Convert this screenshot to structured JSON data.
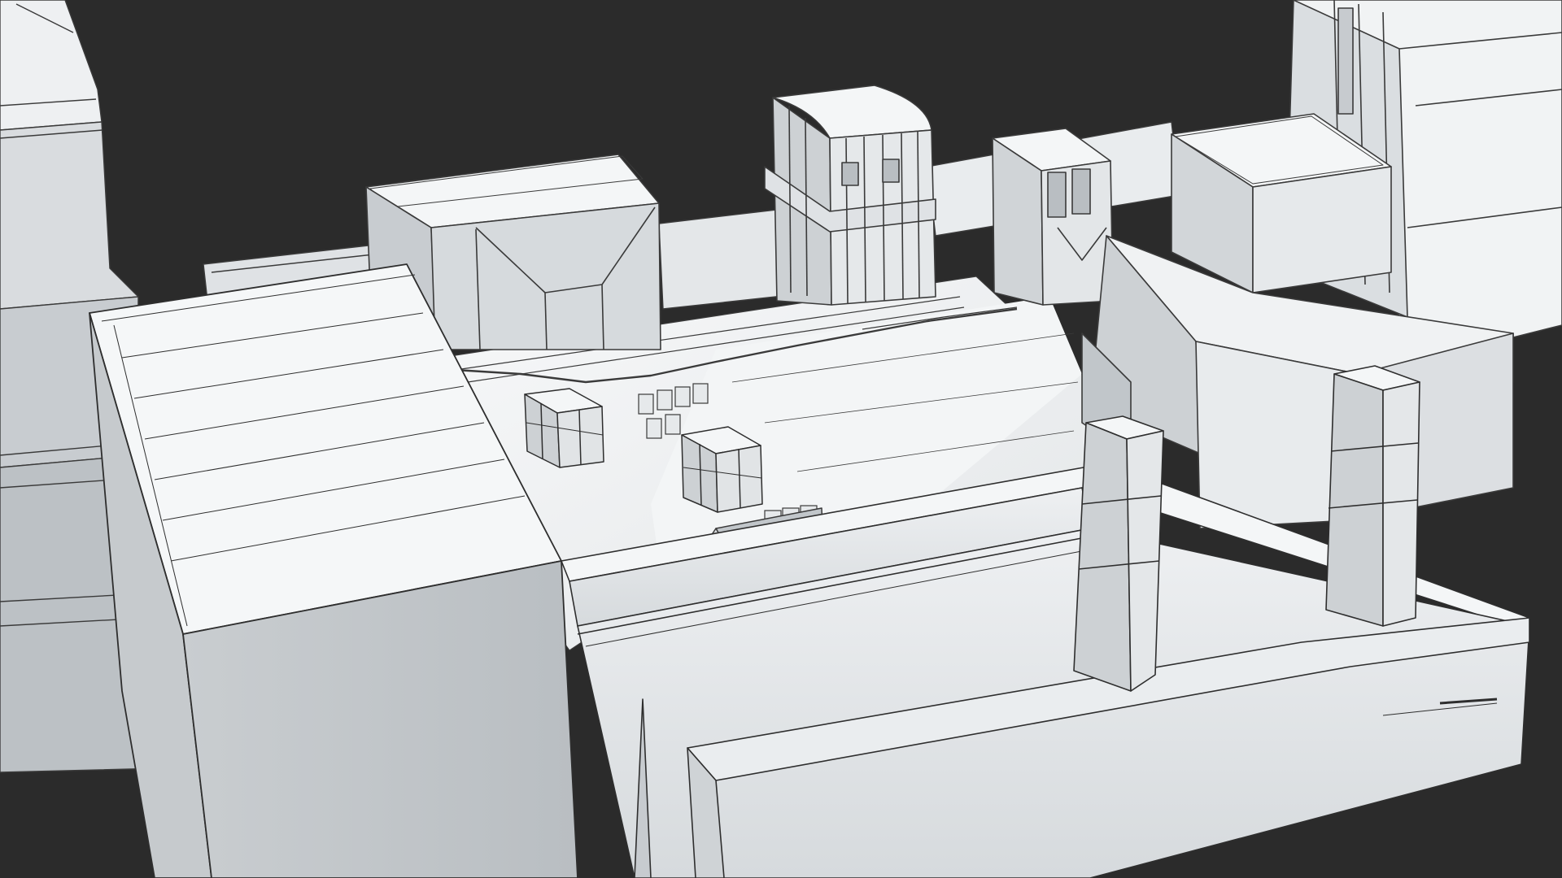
{
  "scene": {
    "subject": "",
    "colors": {
      "background": "#2b2b2b",
      "surface_light": "#f2f4f5",
      "surface_mid": "#e2e5e7",
      "surface_shade": "#cdd1d4",
      "surface_dark": "#b3b8bc",
      "wire": "#3a3a3a"
    }
  }
}
